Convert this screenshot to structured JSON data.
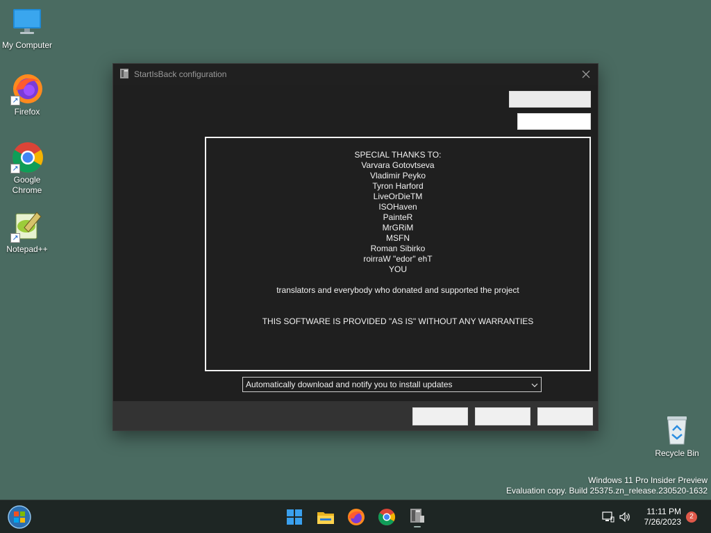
{
  "desktop": {
    "icons": [
      {
        "label": "My Computer"
      },
      {
        "label": "Firefox"
      },
      {
        "label": "Google Chrome"
      },
      {
        "label": "Notepad++"
      },
      {
        "label": "Recycle Bin"
      }
    ]
  },
  "window": {
    "title": "StartIsBack configuration",
    "credits": {
      "heading": "SPECIAL THANKS TO:",
      "names": [
        "Varvara Gotovtseva",
        "Vladimir Peyko",
        "Tyron Harford",
        "LiveOrDieTM",
        "ISOHaven",
        "PainteR",
        "MrGRiM",
        "MSFN",
        "Roman Sibirko",
        "roirraW \"edor\" ehT",
        "YOU"
      ],
      "translators": "translators and everybody who donated and supported the project",
      "disclaimer": "THIS SOFTWARE IS PROVIDED \"AS IS\" WITHOUT ANY WARRANTIES"
    },
    "update_dropdown": {
      "selected": "Automatically download and notify you to install updates"
    }
  },
  "watermark": {
    "line1": "Windows 11 Pro Insider Preview",
    "line2": "Evaluation copy. Build 25375.zn_release.230520-1632"
  },
  "taskbar": {
    "time": "11:11 PM",
    "date": "7/26/2023",
    "notification_count": "2"
  },
  "colors": {
    "desktop": "#4a6b61",
    "window_bg": "#1f1f1f",
    "footer_bg": "#333333",
    "taskbar_bg": "#1e2624"
  }
}
